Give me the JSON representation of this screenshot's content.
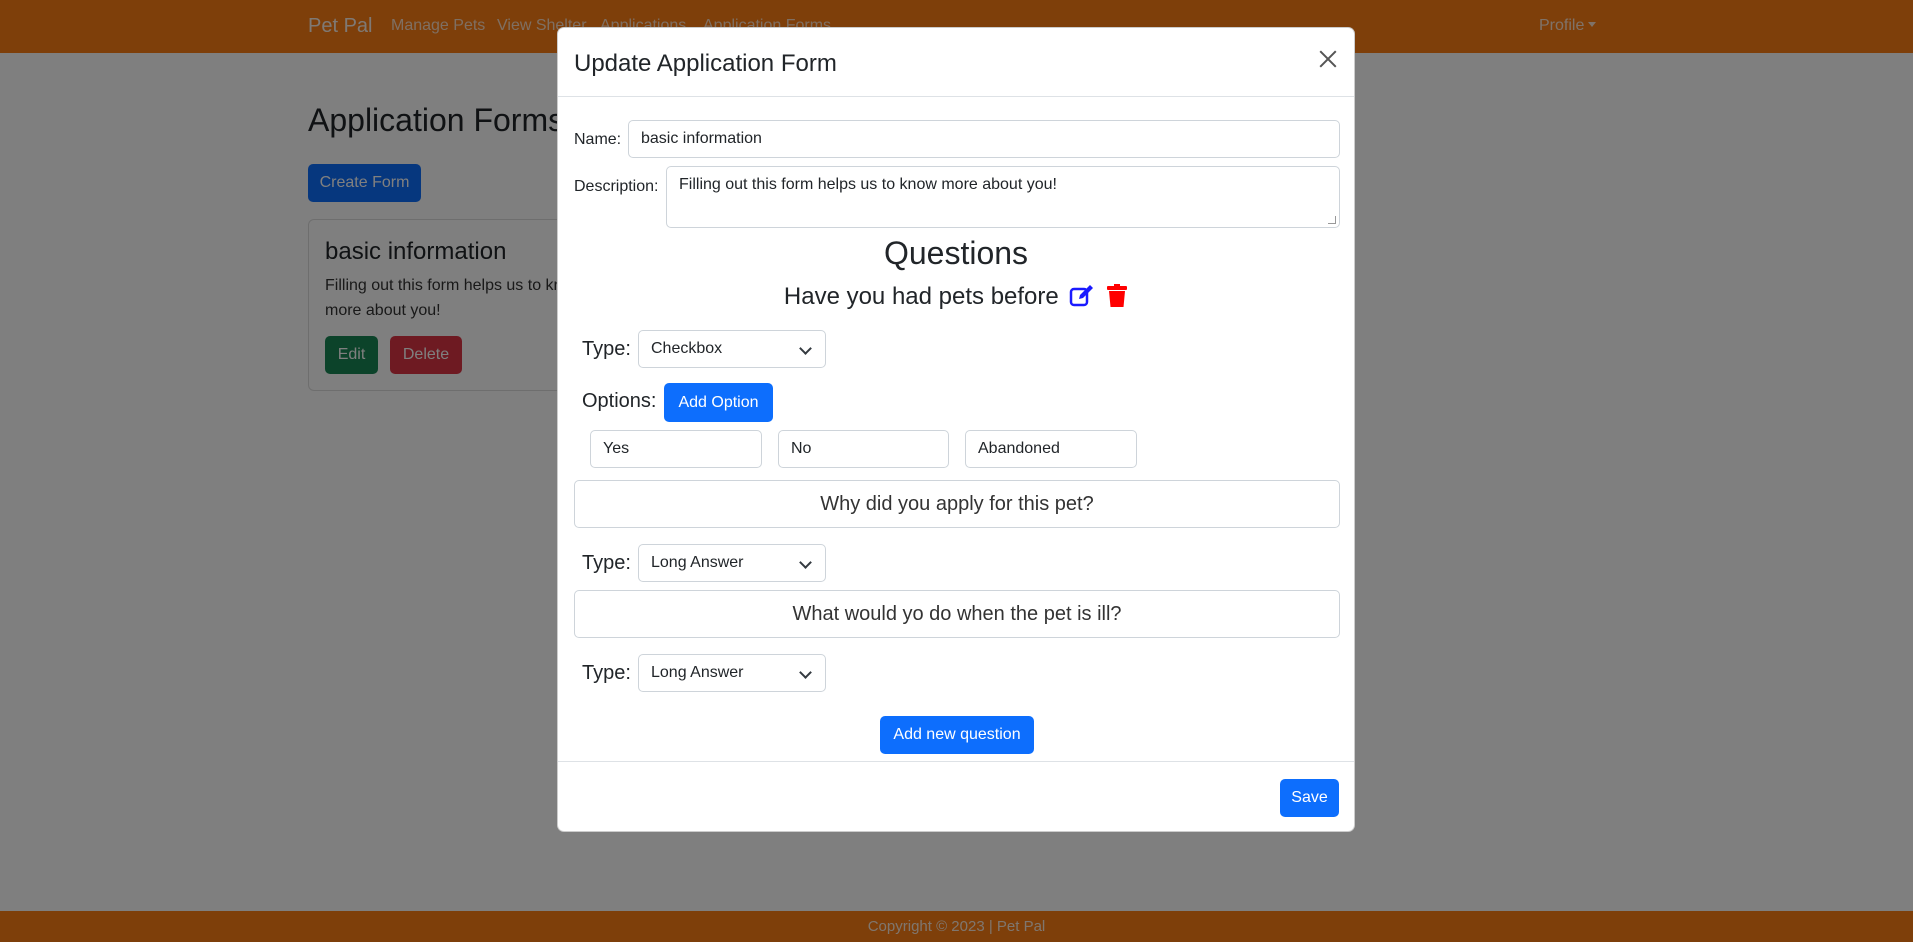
{
  "navbar": {
    "brand": "Pet Pal",
    "links": [
      "Manage Pets",
      "View Shelter",
      "Applications",
      "Application Forms"
    ],
    "profile_label": "Profile"
  },
  "page": {
    "title": "Application Forms",
    "create_button": "Create Form",
    "card": {
      "title": "basic information",
      "text": "Filling out this form helps us to know more about you!",
      "edit_button": "Edit",
      "delete_button": "Delete"
    }
  },
  "footer": {
    "text": "Copyright © 2023 | Pet Pal"
  },
  "modal": {
    "title": "Update Application Form",
    "name_label": "Name:",
    "name_value": "basic information",
    "description_label": "Description:",
    "description_value": "Filling out this form helps us to know more about you!",
    "questions_heading": "Questions",
    "questions": [
      {
        "text": "Have you had pets before",
        "type_label": "Type:",
        "type_value": "Checkbox",
        "options_label": "Options:",
        "add_option_button": "Add Option",
        "options": [
          "Yes",
          "No",
          "Abandoned"
        ]
      },
      {
        "text": "Why did you apply for this pet?",
        "type_label": "Type:",
        "type_value": "Long Answer"
      },
      {
        "text": "What would yo do when the pet is ill?",
        "type_label": "Type:",
        "type_value": "Long Answer"
      }
    ],
    "add_question_button": "Add new question",
    "save_button": "Save"
  },
  "colors": {
    "nav_bg": "#fd7e14",
    "primary": "#0d6efd",
    "success": "#198754",
    "danger": "#dc3545",
    "edit_icon": "#1a1aff",
    "trash_icon": "#ff0000"
  }
}
